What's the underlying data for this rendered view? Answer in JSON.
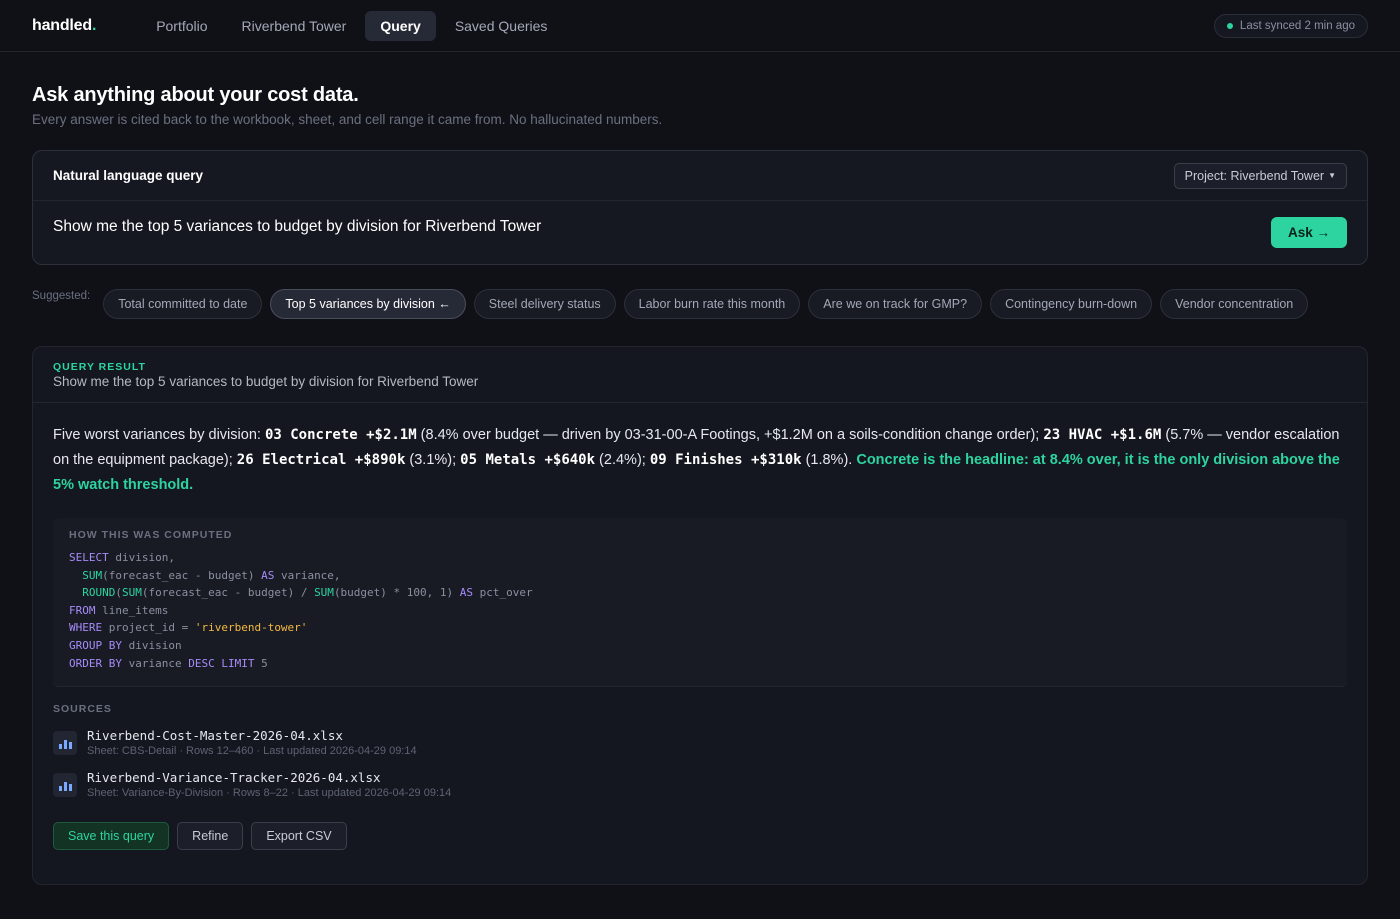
{
  "app": {
    "logo": "handled",
    "logo_dot": ".",
    "nav": [
      "Portfolio",
      "Riverbend Tower",
      "Query",
      "Saved Queries"
    ],
    "active_nav": "Query",
    "sync_status": "Last synced 2 min ago"
  },
  "page": {
    "title": "Ask anything about your cost data.",
    "subtitle": "Every answer is cited back to the workbook, sheet, and cell range it came from. No hallucinated numbers."
  },
  "query": {
    "card_title": "Natural language query",
    "project_select": "Project: Riverbend Tower",
    "text": "Show me the top 5 variances to budget by division for Riverbend Tower",
    "ask_label": "Ask →"
  },
  "suggested": {
    "label": "Suggested:",
    "chips": [
      "Total committed to date",
      "Top 5 variances by division ←",
      "Steel delivery status",
      "Labor burn rate this month",
      "Are we on track for GMP?",
      "Contingency burn-down",
      "Vendor concentration"
    ],
    "active_chip": "Top 5 variances by division ←"
  },
  "result": {
    "label": "QUERY RESULT",
    "query": "Show me the top 5 variances to budget by division for Riverbend Tower",
    "answer": {
      "intro": "Five worst variances by division: ",
      "d1": "03 Concrete +$2.1M",
      "t1": " (8.4% over budget — driven by 03-31-00-A Footings, +$1.2M on a soils-condition change order); ",
      "d2": "23 HVAC +$1.6M",
      "t2": " (5.7% — vendor escalation on the equipment package); ",
      "d3": "26 Electrical +$890k",
      "t3": " (3.1%); ",
      "d4": "05 Metals +$640k",
      "t4": " (2.4%); ",
      "d5": "09 Finishes +$310k",
      "t5": " (1.8%). ",
      "headline": "Concrete is the headline: at 8.4% over, it is the only division above the 5% watch threshold."
    },
    "computed_label": "HOW THIS WAS COMPUTED",
    "sql": {
      "l1_kw": "SELECT",
      "l1": " division,",
      "l2_fn": "SUM",
      "l2a": "(forecast_eac - budget) ",
      "l2_kw": "AS",
      "l2b": " variance,",
      "l3_fn1": "ROUND",
      "l3a": "(",
      "l3_fn2": "SUM",
      "l3b": "(forecast_eac - budget) / ",
      "l3_fn3": "SUM",
      "l3c": "(budget) * 100, 1) ",
      "l3_kw": "AS",
      "l3d": " pct_over",
      "l4_kw": "FROM",
      "l4": " line_items",
      "l5_kw": "WHERE",
      "l5a": " project_id = ",
      "l5_str": "'riverbend-tower'",
      "l6_kw": "GROUP BY",
      "l6": " division",
      "l7_kw1": "ORDER BY",
      "l7a": " variance ",
      "l7_kw2": "DESC",
      "l7b": " ",
      "l7_kw3": "LIMIT",
      "l7c": " 5"
    },
    "sources_label": "SOURCES",
    "sources": [
      {
        "name": "Riverbend-Cost-Master-2026-04.xlsx",
        "meta": "Sheet: CBS-Detail · Rows 12–460 · Last updated 2026-04-29 09:14"
      },
      {
        "name": "Riverbend-Variance-Tracker-2026-04.xlsx",
        "meta": "Sheet: Variance-By-Division · Rows 8–22 · Last updated 2026-04-29 09:14"
      }
    ],
    "actions": [
      "Save this query",
      "Refine",
      "Export CSV"
    ]
  },
  "colors": {
    "accent": "#2dd4a0",
    "background": "#0f1117",
    "sql_keyword": "#a78bfa",
    "sql_string": "#f5b942"
  }
}
